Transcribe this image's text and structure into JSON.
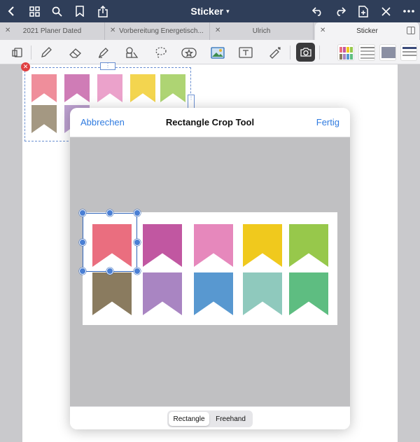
{
  "navbar": {
    "title": "Sticker",
    "icons": [
      "back-icon",
      "grid-icon",
      "search-icon",
      "bookmark-icon",
      "share-icon",
      "undo-icon",
      "redo-icon",
      "add-page-icon",
      "close-icon",
      "more-icon"
    ]
  },
  "tabs": [
    {
      "label": "2021 Planer Dated"
    },
    {
      "label": "Vorbereitung Energetisch..."
    },
    {
      "label": "Ulrich"
    },
    {
      "label": "Sticker"
    }
  ],
  "toolbar": {
    "tools": [
      "page-layout-icon",
      "pen-icon",
      "eraser-icon",
      "highlighter-icon",
      "shapes-icon",
      "lasso-icon",
      "sticker-icon",
      "image-icon",
      "text-icon",
      "laser-pointer-icon",
      "camera-icon"
    ]
  },
  "colors": {
    "accent": "#2f7be0",
    "navbar": "#2f3e59",
    "flags": [
      "#ea6e7f",
      "#c157a1",
      "#e688bc",
      "#f0c91d",
      "#97c84b",
      "#8a7b5f",
      "#a985c2",
      "#5898d0",
      "#8fc9bd",
      "#5ebd81"
    ]
  },
  "modal": {
    "cancel": "Abbrechen",
    "title": "Rectangle Crop Tool",
    "done": "Fertig",
    "modes": [
      "Rectangle",
      "Freehand"
    ],
    "selected_mode": "Rectangle"
  }
}
